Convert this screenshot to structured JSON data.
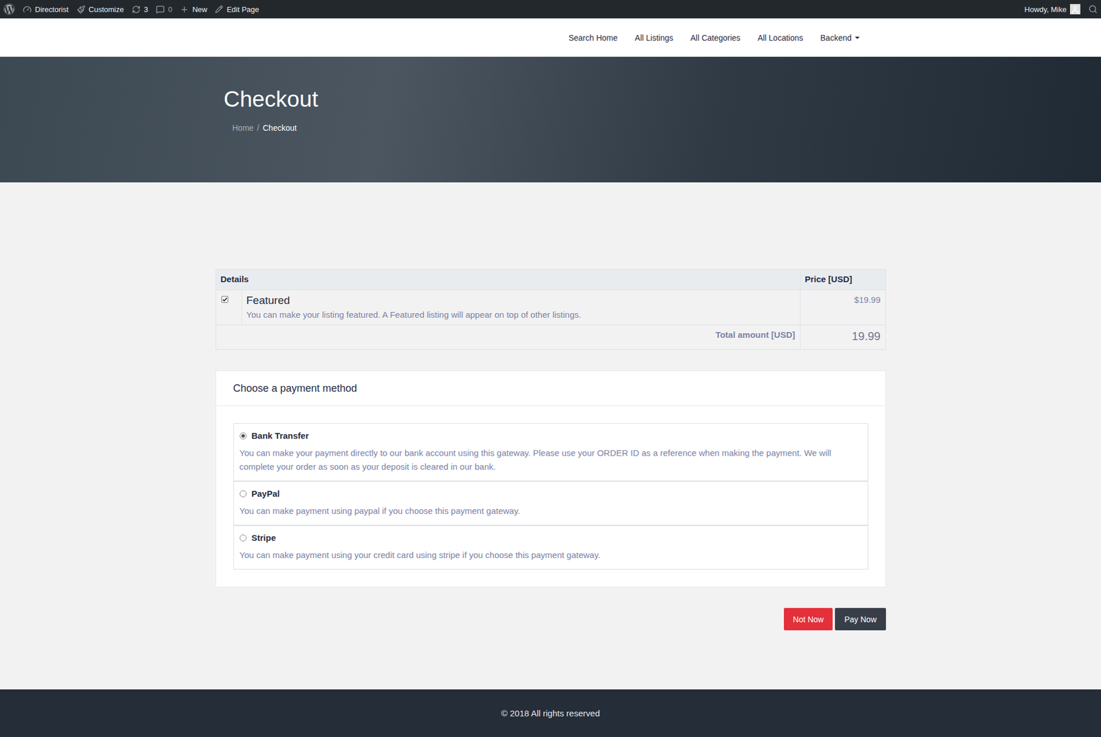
{
  "admin_bar": {
    "site": "Directorist",
    "customize": "Customize",
    "updates": "3",
    "comments": "0",
    "new": "New",
    "edit": "Edit Page",
    "greeting": "Howdy, Mike"
  },
  "nav": [
    {
      "label": "Search Home",
      "dropdown": false
    },
    {
      "label": "All Listings",
      "dropdown": false
    },
    {
      "label": "All Categories",
      "dropdown": false
    },
    {
      "label": "All Locations",
      "dropdown": false
    },
    {
      "label": "Backend",
      "dropdown": true
    }
  ],
  "hero": {
    "title": "Checkout",
    "breadcrumb": [
      {
        "label": "Home",
        "current": false
      },
      {
        "label": "Checkout",
        "current": true
      }
    ],
    "separator": "/"
  },
  "table": {
    "columns": [
      "Details",
      "Price [USD]"
    ],
    "rows": [
      {
        "checked": true,
        "title": "Featured",
        "description": "You can make your listing featured. A Featured listing will appear on top of other listings.",
        "price": "$19.99"
      }
    ],
    "total_label": "Total amount [USD]",
    "total": "19.99"
  },
  "payment": {
    "title": "Choose a payment method",
    "methods": [
      {
        "name": "Bank Transfer",
        "selected": true,
        "description": "You can make your payment directly to our bank account using this gateway. Please use your ORDER ID as a reference when making the payment. We will complete your order as soon as your deposit is cleared in our bank."
      },
      {
        "name": "PayPal",
        "selected": false,
        "description": "You can make payment using paypal if you choose this payment gateway."
      },
      {
        "name": "Stripe",
        "selected": false,
        "description": "You can make payment using your credit card using stripe if you choose this payment gateway."
      }
    ]
  },
  "buttons": [
    {
      "label": "Not Now",
      "kind": "secondary"
    },
    {
      "label": "Pay Now",
      "kind": "primary"
    }
  ],
  "footer": "© 2018 All rights reserved"
}
